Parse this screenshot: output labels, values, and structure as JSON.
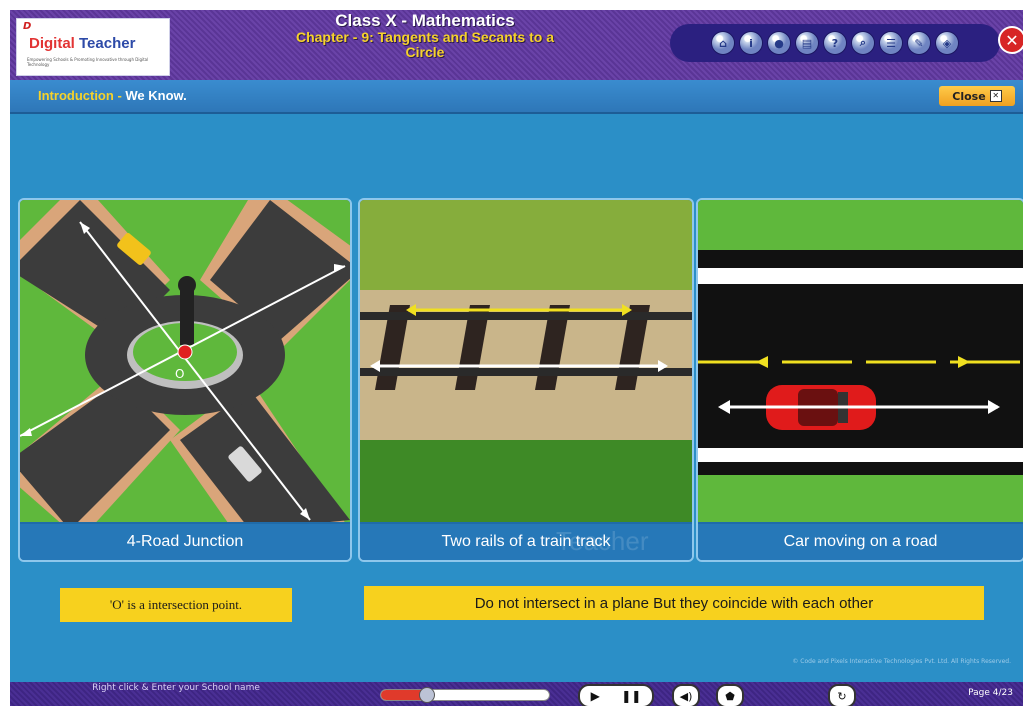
{
  "header": {
    "logo_mark": "D",
    "logo_name_1": "Digital",
    "logo_name_2": " Teacher",
    "logo_tagline": "Empowering Schools & Promoting Innovative through Digital Technology",
    "class_title": "Class X - Mathematics",
    "chapter_title": "Chapter - 9: Tangents and Secants to a Circle",
    "toolbar_icons": [
      "home-icon",
      "info-icon",
      "record-icon",
      "notes-icon",
      "help-icon",
      "search-icon",
      "menu-icon",
      "pencil-icon",
      "eraser-icon"
    ],
    "help_glyph": "?",
    "close_glyph": "✕"
  },
  "section": {
    "label": "Introduction",
    "separator": " - ",
    "title": "We Know.",
    "close_label": "Close",
    "close_glyph": "✕"
  },
  "cards": [
    {
      "caption": "4-Road Junction",
      "point_label": "O"
    },
    {
      "caption": "Two rails of a train track"
    },
    {
      "caption": "Car moving on a road"
    }
  ],
  "notes": {
    "left": "'O' is a intersection point.",
    "right": "Do not intersect  in a plane But they coincide with each other"
  },
  "watermark": "Teacher",
  "copyright": "© Code and Pixels Interactive Technologies Pvt. Ltd. All Rights Reserved.",
  "footer": {
    "school_text": "Right click & Enter your School name",
    "volume_level": 0.27,
    "play_glyph": "▶",
    "pause_glyph": "❚❚",
    "audio_glyph": "◀)",
    "stop_glyph": "⬟",
    "refresh_glyph": "↻",
    "page_label": "Page",
    "page_number": "4/23"
  },
  "colors": {
    "header": "#5a3596",
    "background": "#2b8fc7",
    "accent_yellow": "#f7d11e",
    "close_red": "#d72525"
  }
}
